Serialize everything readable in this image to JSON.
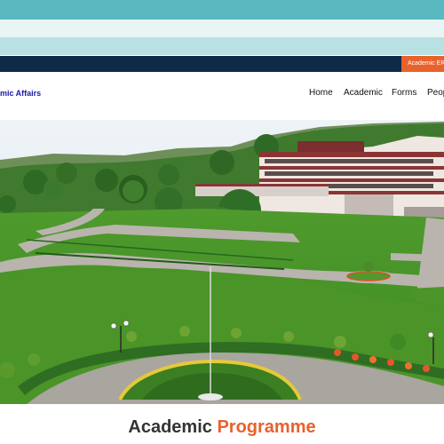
{
  "top_bar": {
    "erp_label": "Academic ER"
  },
  "header": {
    "brand": "mic Affairs"
  },
  "nav": {
    "items": [
      "Home",
      "Academic",
      "Forms",
      "Peop"
    ]
  },
  "section": {
    "title_part1": "Academic",
    "title_part2": "Programme"
  },
  "colors": {
    "accent": "#e8622c",
    "navy": "#0e2a47",
    "brand_blue": "#1a1aa6",
    "teal": "#5ab8c0"
  }
}
